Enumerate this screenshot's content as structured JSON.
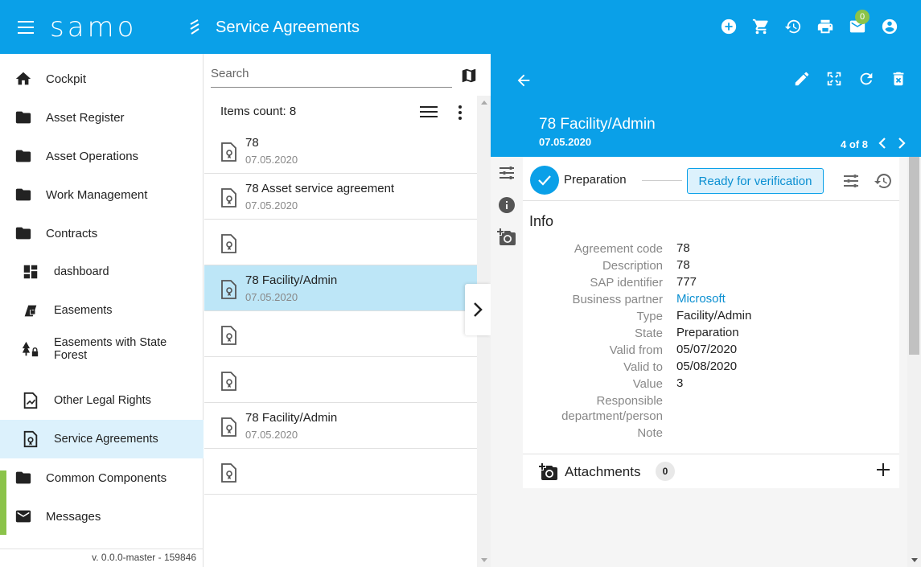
{
  "header": {
    "logo_text": "samo",
    "title": "Service Agreements",
    "messages_badge": "0",
    "icons": [
      "add-circle-icon",
      "cart-icon",
      "history-icon",
      "print-icon",
      "mail-icon",
      "account-icon"
    ]
  },
  "sidebar": {
    "items": [
      {
        "label": "Cockpit",
        "icon": "home-icon"
      },
      {
        "label": "Asset Register",
        "icon": "folder-icon"
      },
      {
        "label": "Asset Operations",
        "icon": "folder-icon"
      },
      {
        "label": "Work Management",
        "icon": "folder-icon"
      },
      {
        "label": "Contracts",
        "icon": "folder-icon"
      },
      {
        "label": "dashboard",
        "icon": "dashboard-icon"
      },
      {
        "label": "Easements",
        "icon": "easement-icon"
      },
      {
        "label": "Easements with State Forest",
        "icon": "forest-lock-icon"
      },
      {
        "label": "Other Legal Rights",
        "icon": "legal-doc-icon"
      },
      {
        "label": "Service Agreements",
        "icon": "agreement-doc-icon"
      },
      {
        "label": "Common Components",
        "icon": "folder-icon"
      },
      {
        "label": "Messages",
        "icon": "mail-icon"
      }
    ],
    "version": "v. 0.0.0-master - 159846"
  },
  "list": {
    "search_placeholder": "Search",
    "items_count": "Items count: 8",
    "rows": [
      {
        "title": "78",
        "date": "07.05.2020"
      },
      {
        "title": "78 Asset service agreement",
        "date": "07.05.2020"
      },
      {
        "title": "",
        "date": ""
      },
      {
        "title": "78 Facility/Admin",
        "date": "07.05.2020"
      },
      {
        "title": "",
        "date": ""
      },
      {
        "title": "",
        "date": ""
      },
      {
        "title": "78 Facility/Admin",
        "date": "07.05.2020"
      },
      {
        "title": "",
        "date": ""
      }
    ]
  },
  "detail": {
    "title": "78 Facility/Admin",
    "date": "07.05.2020",
    "pager": "4 of 8",
    "status_current": "Preparation",
    "status_next_button": "Ready for verification",
    "info_heading": "Info",
    "fields": [
      {
        "key": "Agreement code",
        "value": "78"
      },
      {
        "key": "Description",
        "value": "78"
      },
      {
        "key": "SAP identifier",
        "value": "777"
      },
      {
        "key": "Business partner",
        "value": "Microsoft"
      },
      {
        "key": "Type",
        "value": "Facility/Admin"
      },
      {
        "key": "State",
        "value": "Preparation"
      },
      {
        "key": "Valid from",
        "value": "05/07/2020"
      },
      {
        "key": "Valid to",
        "value": "05/08/2020"
      },
      {
        "key": "Value",
        "value": "3"
      },
      {
        "key": "Responsible department/person",
        "value": ""
      },
      {
        "key": "Note",
        "value": ""
      }
    ],
    "attachments_label": "Attachments",
    "attachments_count": "0"
  },
  "colors": {
    "primary": "#0aa0e8",
    "selected_row": "#bde6f7",
    "active_nav": "#dcf1fc",
    "accent_green": "#8bc34a",
    "link": "#0a8fd1"
  }
}
